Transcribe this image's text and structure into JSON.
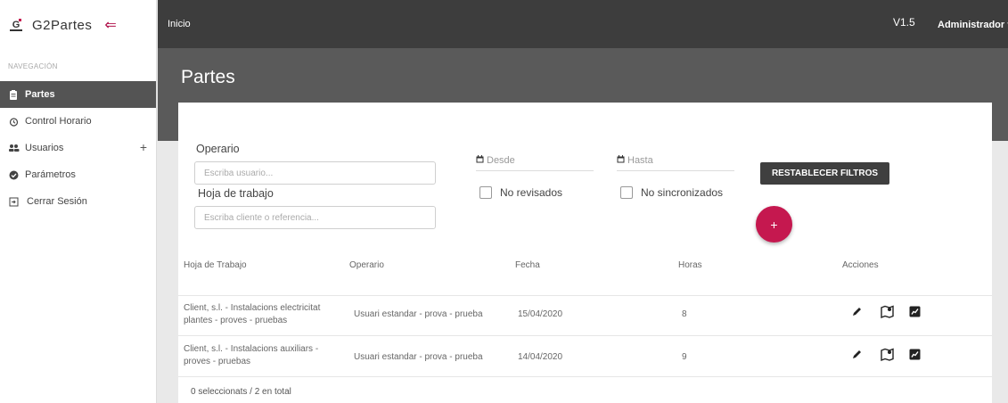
{
  "brand": {
    "name": "G2Partes",
    "logo_text": "G"
  },
  "sidebar": {
    "caption": "NAVEGACIÓN",
    "items": [
      {
        "label": "Partes"
      },
      {
        "label": "Control Horario"
      },
      {
        "label": "Usuarios",
        "extra": "+"
      },
      {
        "label": "Parámetros"
      },
      {
        "label": "Cerrar Sesión"
      }
    ]
  },
  "topbar": {
    "breadcrumb": "Inicio",
    "version": "V1.5",
    "user": "Administrador"
  },
  "page": {
    "title": "Partes"
  },
  "filters": {
    "operario_label": "Operario",
    "operario_placeholder": "Escriba usuario...",
    "hoja_label": "Hoja de trabajo",
    "hoja_placeholder": "Escriba cliente o referencia...",
    "desde": "Desde",
    "hasta": "Hasta",
    "no_revisados": "No revisados",
    "no_sincronizados": "No sincronizados",
    "reset": "RESTABLECER FILTROS",
    "add": "+"
  },
  "table": {
    "headers": [
      "Hoja de Trabajo",
      "Operario",
      "Fecha",
      "Horas",
      "Acciones"
    ],
    "rows": [
      {
        "hoja": "Client, s.l. - Instalacions electricitat plantes - proves - pruebas",
        "operario": "Usuari estandar - prova - prueba",
        "fecha": "15/04/2020",
        "horas": "8"
      },
      {
        "hoja": "Client, s.l. - Instalacions auxiliars - proves - pruebas",
        "operario": "Usuari estandar - prova - prueba",
        "fecha": "14/04/2020",
        "horas": "9"
      }
    ],
    "footer": "0 seleccionats / 2 en total"
  },
  "colors": {
    "accent": "#c5184f",
    "topbar": "#3d3d3d",
    "header_band": "#5a5a5a",
    "active_nav": "#545454"
  }
}
